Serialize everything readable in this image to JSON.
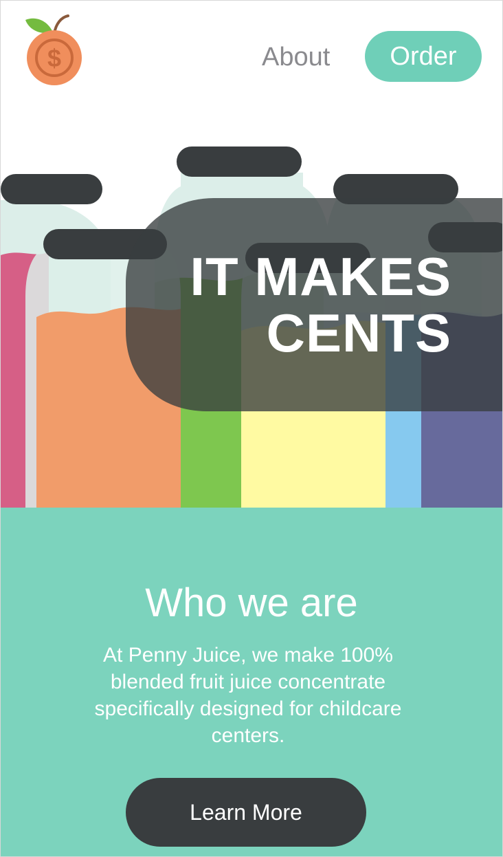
{
  "nav": {
    "logo_icon": "orange-coin-logo-icon",
    "about_label": "About",
    "order_label": "Order"
  },
  "hero": {
    "headline_line1": "IT MAKES",
    "headline_line2": "CENTS"
  },
  "about": {
    "title": "Who we are",
    "description": "At Penny Juice, we make 100% blended fruit juice concentrate specifically designed for childcare centers.",
    "button_label": "Learn More"
  },
  "colors": {
    "accent": "#6fcfb8",
    "section_bg": "#7cd3bd",
    "dark": "#393d3f",
    "logo_orange": "#f08e5c",
    "nav_text": "#8a8a8e"
  }
}
